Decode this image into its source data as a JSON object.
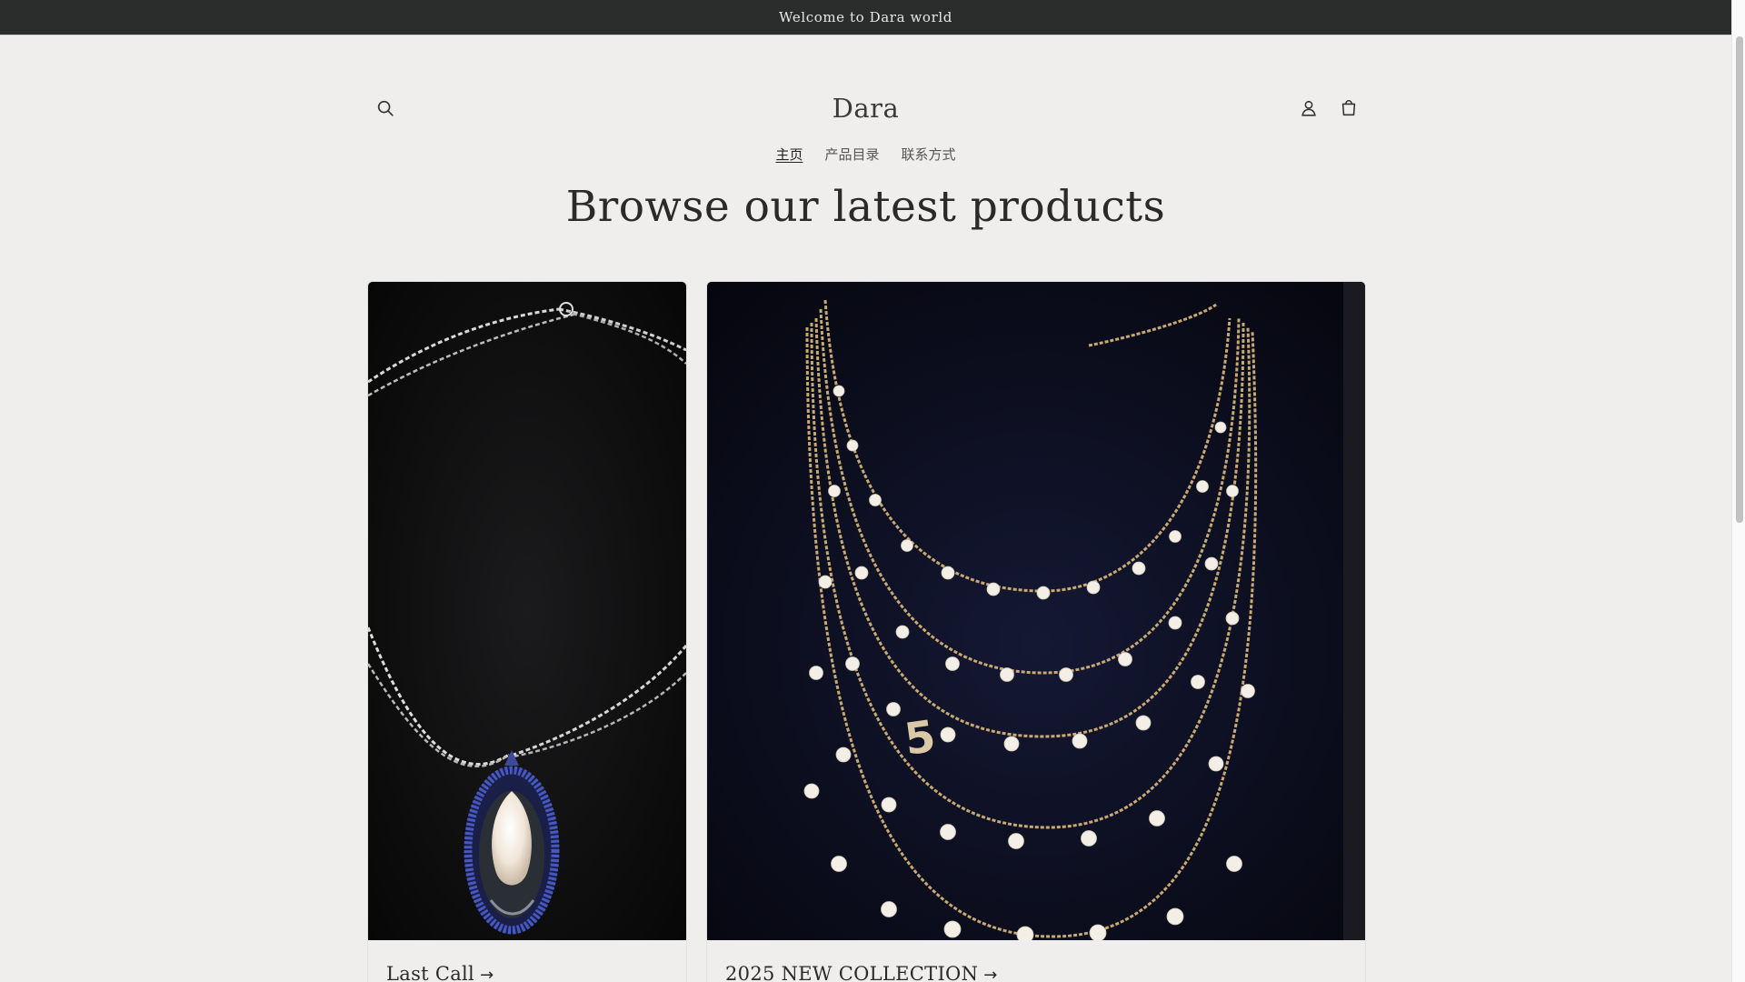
{
  "announcement": {
    "text": "Welcome to Dara world"
  },
  "header": {
    "logo": "Dara",
    "icons": {
      "search": "search-icon",
      "account": "account-icon",
      "cart": "cart-icon"
    }
  },
  "nav": {
    "items": [
      {
        "label": "主页",
        "active": true
      },
      {
        "label": "产品目录",
        "active": false
      },
      {
        "label": "联系方式",
        "active": false
      }
    ]
  },
  "main": {
    "heading": "Browse our latest products",
    "collections": [
      {
        "title": "Last Call",
        "arrow": "→"
      },
      {
        "title": "2025 NEW COLLECTION",
        "arrow": "→"
      }
    ]
  }
}
